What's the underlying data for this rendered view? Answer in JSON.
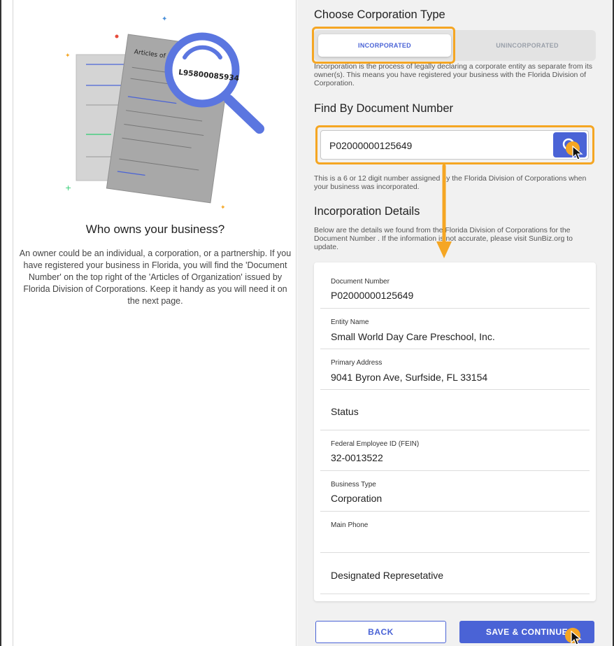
{
  "left": {
    "title": "Who owns your business?",
    "text": "An owner could be an individual, a corporation, or a partnership. If you have registered your business in Florida, you will find the 'Document Number' on the top right of the 'Articles of Organization' issued by Florida Division of Corporations. Keep it handy as you will need it on the next page.",
    "doc_title": "Articles of Org",
    "doc_number": "L95800085934"
  },
  "corp_type": {
    "title": "Choose Corporation Type",
    "options": [
      "INCORPORATED",
      "UNINCORPORATED"
    ],
    "selected": "INCORPORATED",
    "description": "Incorporation is the process of legally declaring a corporate entity as separate from its owner(s). This means you have registered your business with the Florida Division of Corporation."
  },
  "find": {
    "title": "Find By Document Number",
    "value": "P02000000125649",
    "help": "This is a 6 or 12 digit number assigned by the Florida Division of Corporations when your business was incorporated."
  },
  "details": {
    "title": "Incorporation Details",
    "description": "Below are the details we found from the Florida Division of Corporations for the Document Number . If the information is not accurate, please visit SunBiz.org to update.",
    "fields": [
      {
        "label": "Document Number",
        "value": "P02000000125649"
      },
      {
        "label": "Entity Name",
        "value": "Small World Day Care Preschool, Inc."
      },
      {
        "label": "Primary Address",
        "value": "9041 Byron Ave, Surfside, FL 33154"
      },
      {
        "label": "",
        "value": "Status"
      },
      {
        "label": "Federal Employee ID (FEIN)",
        "value": "32-0013522"
      },
      {
        "label": "Business Type",
        "value": "Corporation"
      },
      {
        "label": "Main Phone",
        "value": ""
      },
      {
        "label": "",
        "value": "Designated Represetative"
      }
    ]
  },
  "buttons": {
    "back": "BACK",
    "save": "SAVE & CONTINUE"
  },
  "colors": {
    "accent": "#4a63d6",
    "highlight": "#f5a623"
  }
}
